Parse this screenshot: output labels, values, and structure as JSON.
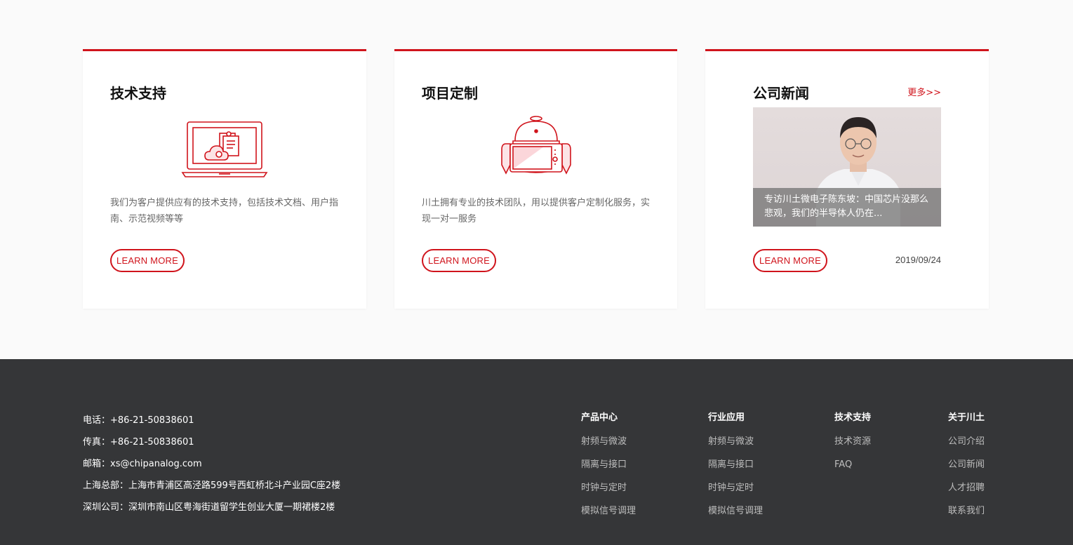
{
  "cards": [
    {
      "title": "技术支持",
      "icon": "laptop-cloud-document-icon",
      "description": "我们为客户提供应有的技术支持，包括技术文档、用户指南、示范视频等等",
      "button": "LEARN MORE"
    },
    {
      "title": "项目定制",
      "icon": "robot-tablet-icon",
      "description": "川土拥有专业的技术团队，用以提供客户定制化服务，实现一对一服务",
      "button": "LEARN MORE"
    },
    {
      "title": "公司新闻",
      "more": "更多>>",
      "news_caption": "专访川土微电子陈东坡：中国芯片没那么悲观，我们的半导体人仍在...",
      "button": "LEARN MORE",
      "date": "2019/09/24"
    }
  ],
  "footer": {
    "contact": [
      {
        "label": "电话：",
        "value": "+86-21-50838601"
      },
      {
        "label": "传真：",
        "value": "+86-21-50838601"
      },
      {
        "label": "邮箱：",
        "value": "xs@chipanalog.com"
      },
      {
        "label": "上海总部：",
        "value": "上海市青浦区高泾路599号西虹桥北斗产业园C座2楼"
      },
      {
        "label": "深圳公司：",
        "value": "深圳市南山区粤海街道留学生创业大厦一期裙楼2楼"
      }
    ],
    "columns": [
      {
        "title": "产品中心",
        "items": [
          "射频与微波",
          "隔离与接口",
          "时钟与定时",
          "模拟信号调理"
        ]
      },
      {
        "title": "行业应用",
        "items": [
          "射频与微波",
          "隔离与接口",
          "时钟与定时",
          "模拟信号调理"
        ]
      },
      {
        "title": "技术支持",
        "items": [
          "技术资源",
          "FAQ"
        ]
      },
      {
        "title": "关于川土",
        "items": [
          "公司介绍",
          "公司新闻",
          "人才招聘",
          "联系我们"
        ]
      }
    ]
  },
  "colors": {
    "accent": "#d0141c",
    "footer_bg": "#353638",
    "page_bg": "#fafafa"
  }
}
